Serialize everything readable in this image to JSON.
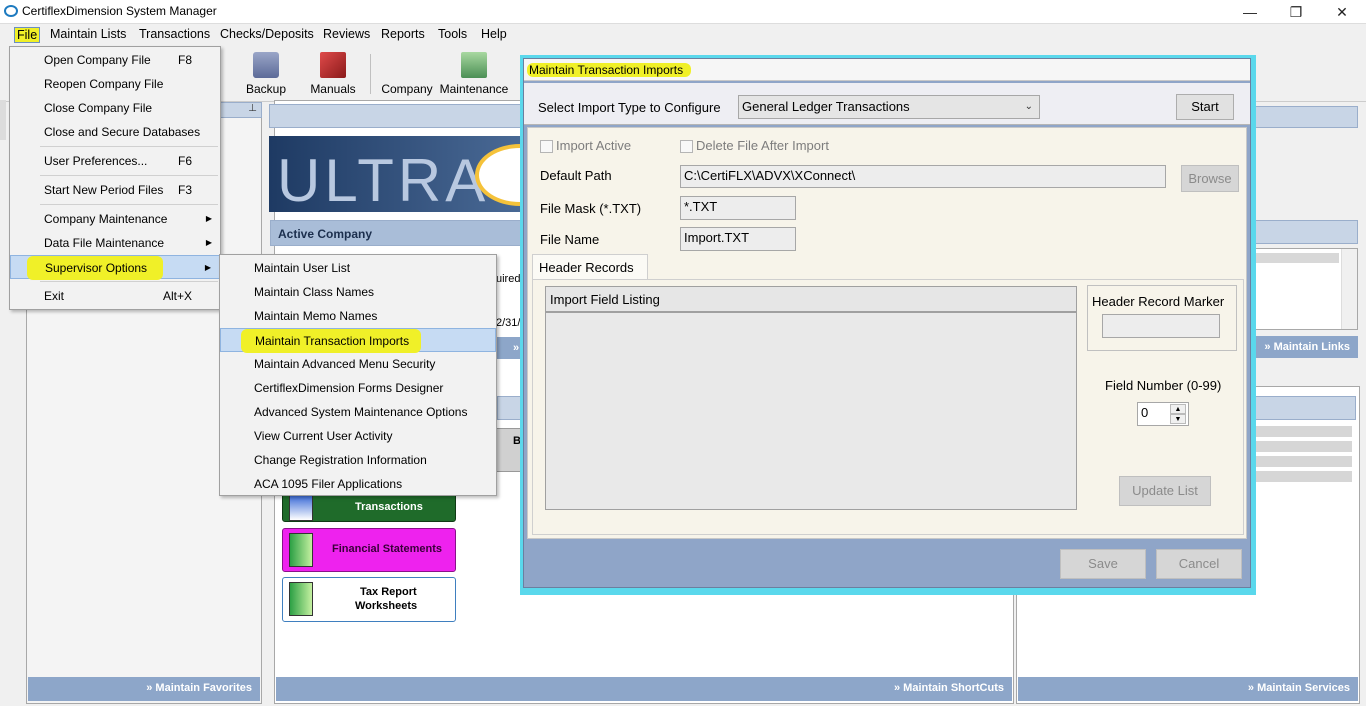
{
  "window": {
    "title": "CertiflexDimension System Manager"
  },
  "menubar": {
    "items": [
      {
        "label": "File",
        "hl": true
      },
      {
        "label": "Maintain Lists"
      },
      {
        "label": "Transactions"
      },
      {
        "label": "Checks/Deposits"
      },
      {
        "label": "Reviews"
      },
      {
        "label": "Reports"
      },
      {
        "label": "Tools"
      },
      {
        "label": "Help"
      }
    ]
  },
  "toolbar": {
    "backup": "Backup",
    "manuals": "Manuals",
    "company": "Company",
    "maintenance": "Maintenance"
  },
  "file_menu": {
    "items": [
      {
        "label": "Open Company File",
        "key": "F8"
      },
      {
        "label": "Reopen Company File",
        "key": ""
      },
      {
        "label": "Close Company File",
        "key": ""
      },
      {
        "label": "Close and Secure Databases",
        "key": ""
      },
      {
        "label": "User Preferences...",
        "key": "F6"
      },
      {
        "label": "Start New Period Files",
        "key": "F3"
      },
      {
        "label": "Company Maintenance",
        "key": ""
      },
      {
        "label": "Data File Maintenance",
        "key": ""
      },
      {
        "label": "Supervisor Options",
        "key": ""
      },
      {
        "label": "Exit",
        "key": "Alt+X"
      }
    ]
  },
  "supervisor_menu": {
    "items": [
      "Maintain User List",
      "Maintain Class Names",
      "Maintain Memo Names",
      "Maintain Transaction Imports",
      "Maintain Advanced Menu Security",
      "CertiflexDimension Forms Designer",
      "Advanced System Maintenance Options",
      "View Current User Activity",
      "Change Registration Information",
      "ACA 1095 Filer Applications"
    ]
  },
  "background": {
    "logo_text": "ULTRA",
    "active_company": "Active Company",
    "required_fragment": "uired",
    "date_fragment": "2/31/",
    "b_fragment": "B",
    "transactions": "Transactions",
    "financial_statements": "Financial Statements",
    "tax_report": "Tax Report",
    "worksheets": "Worksheets",
    "maintain_links": "» Maintain Links",
    "maintain_favorites": "» Maintain Favorites",
    "maintain_shortcuts": "» Maintain ShortCuts",
    "maintain_services": "» Maintain Services",
    "pin_glyph": "⊥",
    "chevron": "»"
  },
  "dialog": {
    "title": "Maintain Transaction Imports",
    "import_type_label": "Select Import Type to Configure",
    "import_type_value": "General Ledger Transactions",
    "start_label": "Start",
    "import_active_label": "Import Active",
    "delete_after_label": "Delete File After Import",
    "default_path_label": "Default Path",
    "default_path_value": "C:\\CertiFLX\\ADVX\\XConnect\\",
    "browse_label": "Browse",
    "file_mask_label": "File Mask (*.TXT)",
    "file_mask_value": "*.TXT",
    "file_name_label": "File Name",
    "file_name_value": "Import.TXT",
    "tab_label": "Header Records",
    "listing_header": "Import Field Listing",
    "header_marker_label": "Header Record Marker",
    "header_marker_value": "",
    "field_number_label": "Field Number (0-99)",
    "field_number_value": "0",
    "update_list_label": "Update List",
    "save_label": "Save",
    "cancel_label": "Cancel"
  },
  "colors": {
    "highlight": "#f0f028",
    "dialog_border": "#5ad8ec",
    "panel_blue": "#8da6c9"
  }
}
